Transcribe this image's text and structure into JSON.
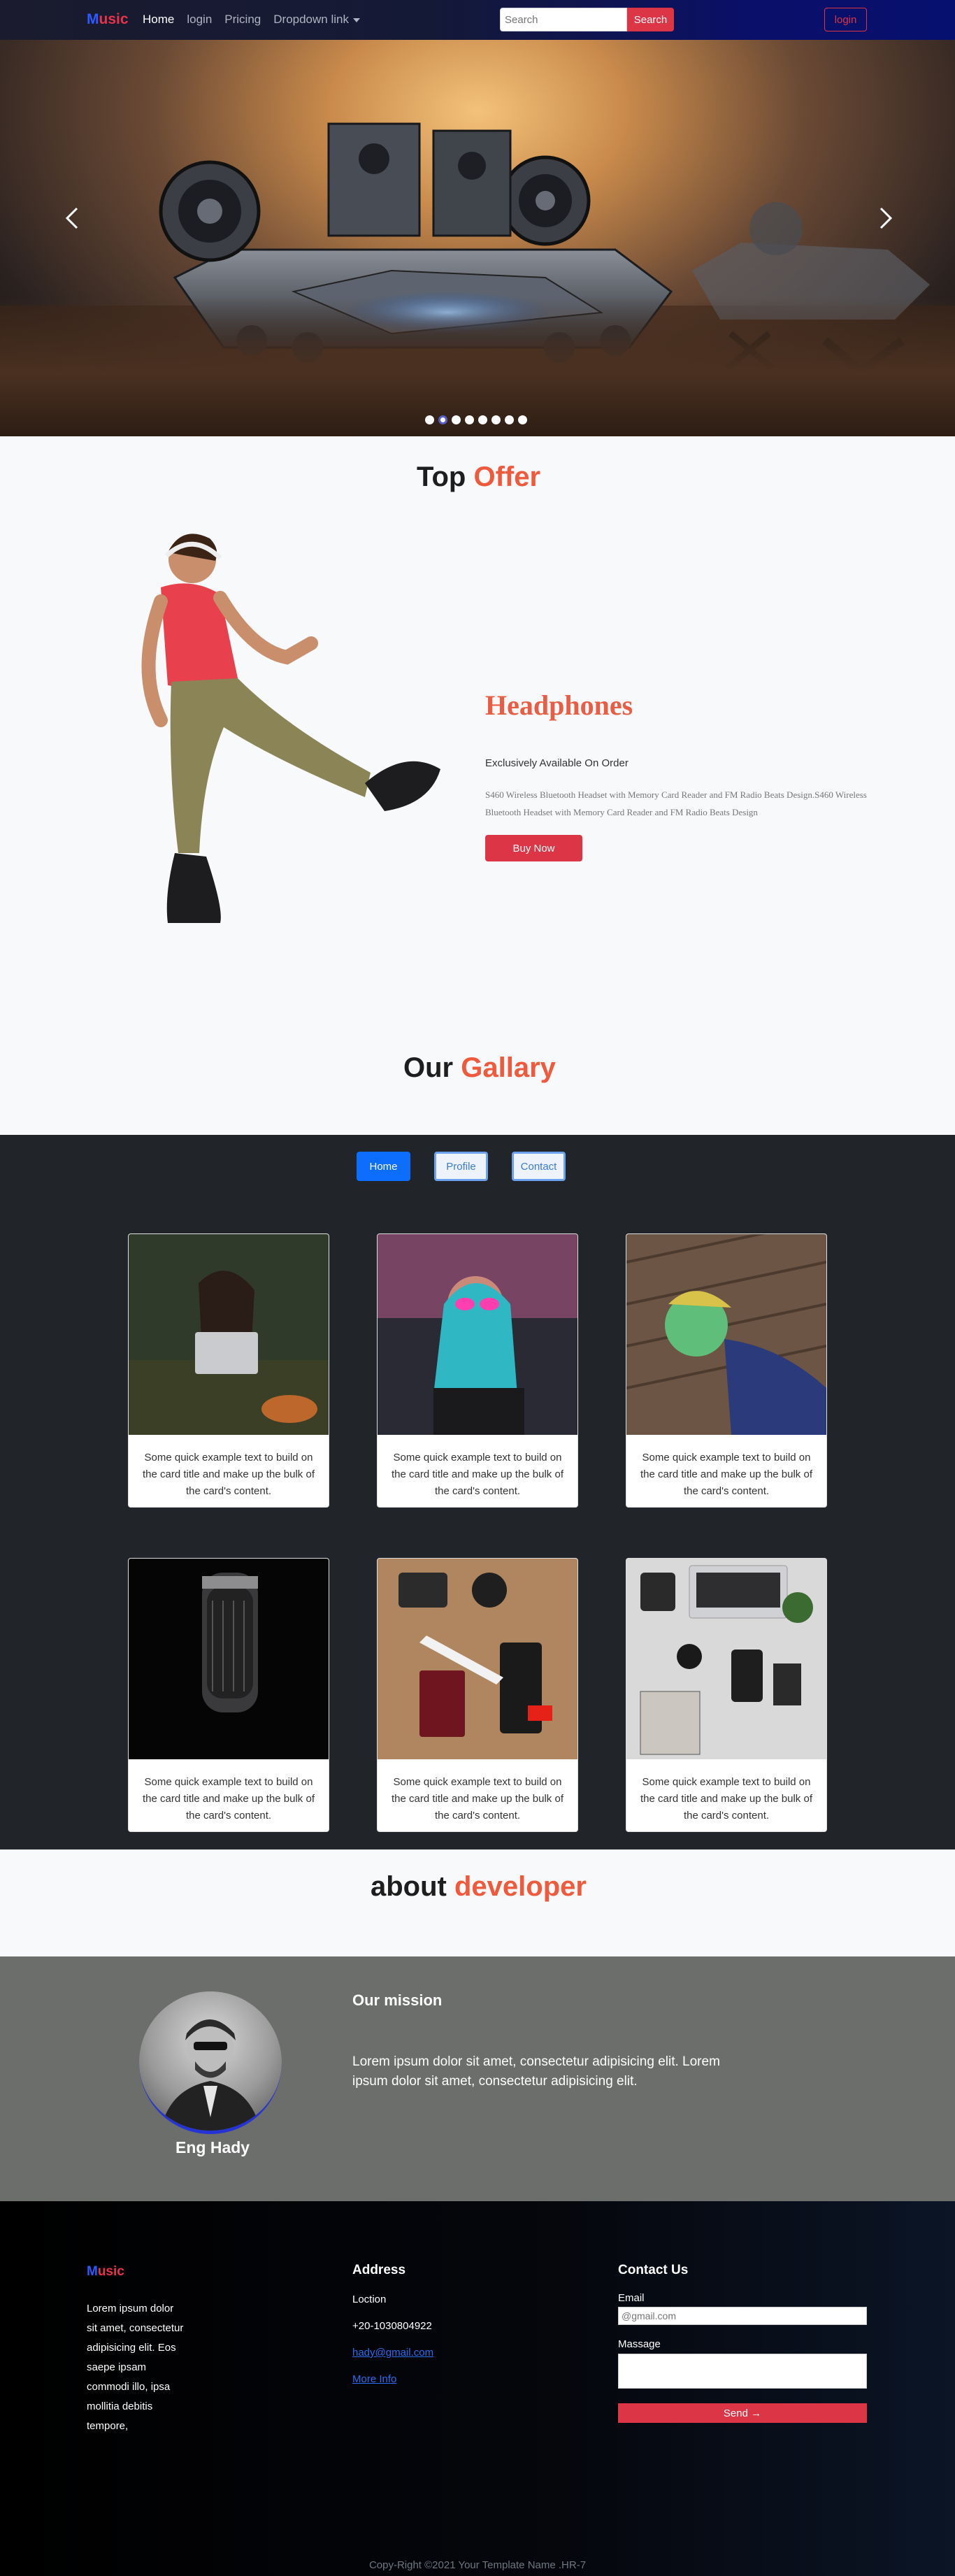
{
  "navbar": {
    "brand_first": "M",
    "brand_rest": "usic",
    "links": [
      "Home",
      "login",
      "Pricing",
      "Dropdown link"
    ],
    "search_placeholder": "Search",
    "search_button": "Search",
    "login_button": "login"
  },
  "carousel": {
    "slide_count": 8,
    "active_slide": 2
  },
  "offer": {
    "title_plain": "Top",
    "title_accent": "Offer",
    "product": "Headphones",
    "subtitle": "Exclusively Available On Order",
    "description": "S460 Wireless Bluetooth Headset with Memory Card Reader and FM Radio Beats Design.S460 Wireless Bluetooth Headset with Memory Card Reader and FM Radio Beats Design",
    "button": "Buy Now"
  },
  "gallery": {
    "title_plain": "Our",
    "title_accent": "Gallary",
    "tabs": [
      "Home",
      "Profile",
      "Contact"
    ],
    "cards": [
      {
        "text": "Some quick example text to build on the card title and make up the bulk of the card's content.",
        "photo": "woman-laptop-forest"
      },
      {
        "text": "Some quick example text to build on the card title and make up the bulk of the card's content.",
        "photo": "woman-neon-glasses"
      },
      {
        "text": "Some quick example text to build on the card title and make up the bulk of the card's content.",
        "photo": "man-neon-headphones"
      },
      {
        "text": "Some quick example text to build on the card title and make up the bulk of the card's content.",
        "photo": "studio-microphone"
      },
      {
        "text": "Some quick example text to build on the card title and make up the bulk of the card's content.",
        "photo": "travel-flatlay"
      },
      {
        "text": "Some quick example text to build on the card title and make up the bulk of the card's content.",
        "photo": "desk-flatlay"
      }
    ]
  },
  "about": {
    "title_plain": "about",
    "title_accent": "developer",
    "name": "Eng Hady",
    "mission_title": "Our mission",
    "mission_text": "Lorem ipsum dolor sit amet, consectetur adipisicing elit. Lorem ipsum dolor sit amet, consectetur adipisicing elit."
  },
  "footer": {
    "brand_first": "M",
    "brand_rest": "usic",
    "about_text": "Lorem ipsum dolor sit amet, consectetur adipisicing elit. Eos saepe ipsam commodi illo, ipsa mollitia debitis tempore,",
    "address_heading": "Address",
    "location": "Loction",
    "phone": "+20-1030804922",
    "email": "hady@gmail.com",
    "more_info": "More Info",
    "contact_heading": "Contact Us",
    "email_label": "Email",
    "email_placeholder": "@gmail.com",
    "message_label": "Massage",
    "send_button": "Send →",
    "copyright": "Copy-Right ©2021 Your Template Name .HR-7"
  },
  "colors": {
    "accent_red": "#dc3545",
    "heading_accent": "#f05a3c",
    "brand_blue": "#2d5bff",
    "tab_blue": "#0d6efd"
  }
}
